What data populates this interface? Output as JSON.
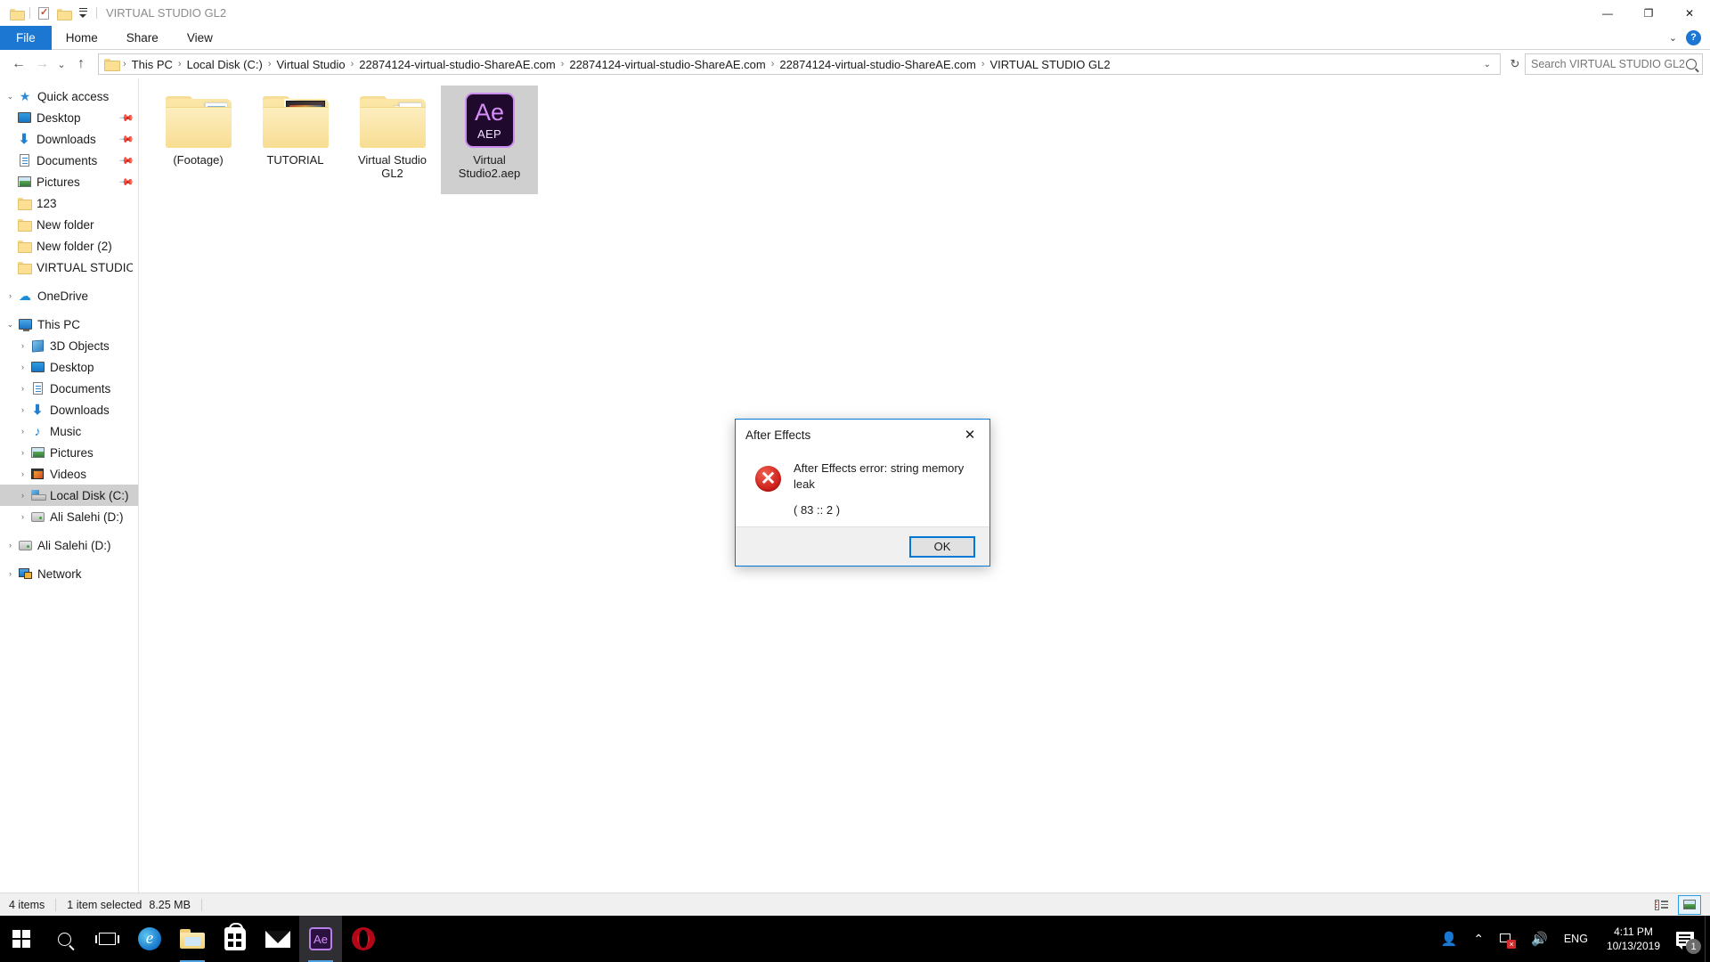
{
  "window": {
    "title": "VIRTUAL STUDIO GL2",
    "quick_access_icons": [
      "folder-icon",
      "properties-icon",
      "new-folder-icon",
      "customize-qat-icon"
    ],
    "controls": {
      "minimize": "—",
      "maximize": "❐",
      "close": "✕"
    },
    "ribbon_collapse": "⌄",
    "help": "?"
  },
  "ribbon": {
    "tabs": [
      {
        "label": "File",
        "active": true
      },
      {
        "label": "Home",
        "active": false
      },
      {
        "label": "Share",
        "active": false
      },
      {
        "label": "View",
        "active": false
      }
    ]
  },
  "addressbar": {
    "back": "←",
    "forward": "→",
    "recent": "⌄",
    "up": "↑",
    "crumbs": [
      "This PC",
      "Local Disk (C:)",
      "Virtual Studio",
      "22874124-virtual-studio-ShareAE.com",
      "22874124-virtual-studio-ShareAE.com",
      "22874124-virtual-studio-ShareAE.com",
      "VIRTUAL STUDIO GL2"
    ],
    "separator": "›",
    "dropdown_caret": "⌄",
    "refresh": "↻"
  },
  "search": {
    "placeholder": "Search VIRTUAL STUDIO GL2",
    "value": ""
  },
  "sidebar": {
    "groups": [
      {
        "name": "quick-access",
        "items": [
          {
            "label": "Quick access",
            "icon": "star-icon",
            "expander": "⌄",
            "indent": 0,
            "pinned": false,
            "selected": false
          },
          {
            "label": "Desktop",
            "icon": "desktop-icon",
            "expander": "",
            "indent": 1,
            "pinned": true,
            "selected": false
          },
          {
            "label": "Downloads",
            "icon": "download-icon",
            "expander": "",
            "indent": 1,
            "pinned": true,
            "selected": false
          },
          {
            "label": "Documents",
            "icon": "documents-icon",
            "expander": "",
            "indent": 1,
            "pinned": true,
            "selected": false
          },
          {
            "label": "Pictures",
            "icon": "pictures-icon",
            "expander": "",
            "indent": 1,
            "pinned": true,
            "selected": false
          },
          {
            "label": "123",
            "icon": "folder-icon",
            "expander": "",
            "indent": 1,
            "pinned": false,
            "selected": false
          },
          {
            "label": "New folder",
            "icon": "folder-icon",
            "expander": "",
            "indent": 1,
            "pinned": false,
            "selected": false
          },
          {
            "label": "New folder (2)",
            "icon": "folder-icon",
            "expander": "",
            "indent": 1,
            "pinned": false,
            "selected": false
          },
          {
            "label": "VIRTUAL STUDIO Gl",
            "icon": "folder-icon",
            "expander": "",
            "indent": 1,
            "pinned": false,
            "selected": false
          }
        ]
      },
      {
        "name": "onedrive",
        "items": [
          {
            "label": "OneDrive",
            "icon": "cloud-icon",
            "expander": "›",
            "indent": 0,
            "pinned": false,
            "selected": false
          }
        ]
      },
      {
        "name": "this-pc",
        "items": [
          {
            "label": "This PC",
            "icon": "pc-icon",
            "expander": "⌄",
            "indent": 0,
            "pinned": false,
            "selected": false
          },
          {
            "label": "3D Objects",
            "icon": "3d-objects-icon",
            "expander": "›",
            "indent": 1,
            "pinned": false,
            "selected": false
          },
          {
            "label": "Desktop",
            "icon": "desktop-icon",
            "expander": "›",
            "indent": 1,
            "pinned": false,
            "selected": false
          },
          {
            "label": "Documents",
            "icon": "documents-icon",
            "expander": "›",
            "indent": 1,
            "pinned": false,
            "selected": false
          },
          {
            "label": "Downloads",
            "icon": "download-icon",
            "expander": "›",
            "indent": 1,
            "pinned": false,
            "selected": false
          },
          {
            "label": "Music",
            "icon": "music-icon",
            "expander": "›",
            "indent": 1,
            "pinned": false,
            "selected": false
          },
          {
            "label": "Pictures",
            "icon": "pictures-icon",
            "expander": "›",
            "indent": 1,
            "pinned": false,
            "selected": false
          },
          {
            "label": "Videos",
            "icon": "videos-icon",
            "expander": "›",
            "indent": 1,
            "pinned": false,
            "selected": false
          },
          {
            "label": "Local Disk (C:)",
            "icon": "local-disk-icon",
            "expander": "›",
            "indent": 1,
            "pinned": false,
            "selected": true
          },
          {
            "label": "Ali Salehi (D:)",
            "icon": "drive-icon",
            "expander": "›",
            "indent": 1,
            "pinned": false,
            "selected": false
          }
        ]
      },
      {
        "name": "drives",
        "items": [
          {
            "label": "Ali Salehi (D:)",
            "icon": "drive-icon",
            "expander": "›",
            "indent": 0,
            "pinned": false,
            "selected": false
          }
        ]
      },
      {
        "name": "network",
        "items": [
          {
            "label": "Network",
            "icon": "network-icon",
            "expander": "›",
            "indent": 0,
            "pinned": false,
            "selected": false
          }
        ]
      }
    ]
  },
  "files": [
    {
      "name": "(Footage)",
      "type": "folder-with-files",
      "selected": false
    },
    {
      "name": "TUTORIAL",
      "type": "folder-with-media",
      "selected": false
    },
    {
      "name": "Virtual Studio GL2",
      "type": "folder-with-docs",
      "selected": false
    },
    {
      "name": "Virtual Studio2.aep",
      "type": "after-effects-project",
      "selected": true,
      "badge_big": "Ae",
      "badge_sub": "AEP"
    }
  ],
  "statusbar": {
    "item_count": "4 items",
    "selection": "1 item selected",
    "size": "8.25 MB",
    "view_details": "details-view-icon",
    "view_large_icons": "large-icons-view-icon"
  },
  "dialog": {
    "title": "After Effects",
    "close": "✕",
    "error_icon": "error-x-icon",
    "message_line1": "After Effects error: string memory leak",
    "message_line2": "( 83 :: 2 )",
    "ok_label": "OK"
  },
  "taskbar": {
    "items": [
      {
        "name": "start-button",
        "icon": "windows-logo-icon",
        "active": false,
        "running": false
      },
      {
        "name": "search-button",
        "icon": "search-icon",
        "active": false,
        "running": false
      },
      {
        "name": "task-view-button",
        "icon": "task-view-icon",
        "active": false,
        "running": false
      },
      {
        "name": "edge-button",
        "icon": "edge-icon",
        "active": false,
        "running": false
      },
      {
        "name": "file-explorer-button",
        "icon": "file-explorer-icon",
        "active": false,
        "running": true
      },
      {
        "name": "store-button",
        "icon": "microsoft-store-icon",
        "active": false,
        "running": false
      },
      {
        "name": "mail-button",
        "icon": "mail-icon",
        "active": false,
        "running": false
      },
      {
        "name": "after-effects-button",
        "icon": "after-effects-icon",
        "active": true,
        "running": true
      },
      {
        "name": "opera-button",
        "icon": "opera-icon",
        "active": false,
        "running": false
      }
    ],
    "tray": {
      "people": "people-icon",
      "chevron": "⌃",
      "network": "network-disconnected-icon",
      "volume": "🔊",
      "language": "ENG",
      "time": "4:11 PM",
      "date": "10/13/2019",
      "notification_count": "1"
    }
  },
  "colors": {
    "accent": "#0078d7",
    "file_tab": "#1b77d2",
    "selection": "#cfcfcf",
    "error_red": "#cc1b16",
    "ae_purple": "#d58ef5",
    "taskbar_bg": "#000000"
  }
}
